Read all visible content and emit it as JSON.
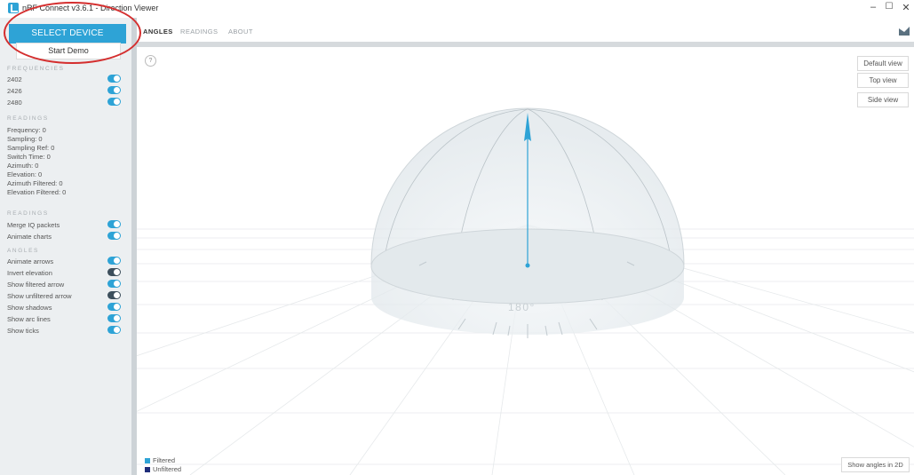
{
  "window": {
    "title": "nRF Connect v3.6.1 - Direction Viewer",
    "minimize": "–",
    "maximize": "☐",
    "close": "✕"
  },
  "sidebar": {
    "select_device": "SELECT DEVICE",
    "start_demo": "Start Demo",
    "frequencies_label": "FREQUENCIES",
    "frequencies": [
      {
        "label": "2402",
        "on": true
      },
      {
        "label": "2426",
        "on": true
      },
      {
        "label": "2480",
        "on": true
      }
    ],
    "readings_label": "READINGS",
    "readings": [
      "Frequency: 0",
      "Sampling: 0",
      "Sampling Ref: 0",
      "Switch Time: 0",
      "Azimuth: 0",
      "Elevation: 0",
      "Azimuth Filtered: 0",
      "Elevation Filtered: 0"
    ],
    "readings_options_label": "READINGS",
    "readings_options": [
      {
        "label": "Merge IQ packets",
        "on": true
      },
      {
        "label": "Animate charts",
        "on": true
      }
    ],
    "angles_label": "ANGLES",
    "angles_options": [
      {
        "label": "Animate arrows",
        "on": true
      },
      {
        "label": "Invert elevation",
        "on": false
      },
      {
        "label": "Show filtered arrow",
        "on": true
      },
      {
        "label": "Show unfiltered arrow",
        "on": false
      },
      {
        "label": "Show shadows",
        "on": true
      },
      {
        "label": "Show arc lines",
        "on": true
      },
      {
        "label": "Show ticks",
        "on": true
      }
    ]
  },
  "nav": {
    "tabs": [
      "ANGLES",
      "READINGS",
      "ABOUT"
    ],
    "active_tab": "ANGLES"
  },
  "viewport": {
    "help": "?",
    "view_buttons": [
      "Default view",
      "Top view",
      "Side view"
    ],
    "dial_label": "180°",
    "legend": [
      {
        "label": "Filtered",
        "color": "#2ea3d6"
      },
      {
        "label": "Unfiltered",
        "color": "#1f2d7a"
      }
    ],
    "show_2d": "Show angles in 2D"
  },
  "colors": {
    "accent": "#2ea3d6",
    "sidebar_bg": "#eceff1",
    "annotation": "#d42e2e"
  }
}
